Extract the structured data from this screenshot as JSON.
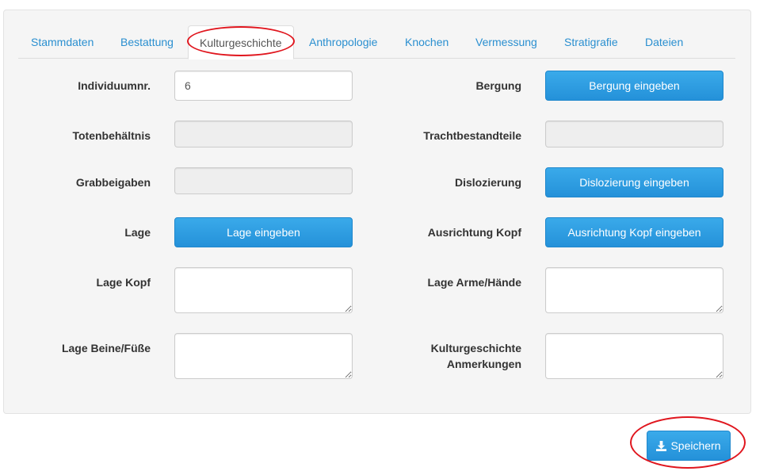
{
  "tabs": [
    {
      "label": "Stammdaten"
    },
    {
      "label": "Bestattung"
    },
    {
      "label": "Kulturgeschichte"
    },
    {
      "label": "Anthropologie"
    },
    {
      "label": "Knochen"
    },
    {
      "label": "Vermessung"
    },
    {
      "label": "Stratigrafie"
    },
    {
      "label": "Dateien"
    }
  ],
  "active_tab": "Kulturgeschichte",
  "form": {
    "individuumnr": {
      "label": "Individuumnr.",
      "value": "6"
    },
    "bergung": {
      "label": "Bergung",
      "button": "Bergung eingeben"
    },
    "totenbehaeltnis": {
      "label": "Totenbehältnis",
      "value": ""
    },
    "trachtbestandteile": {
      "label": "Trachtbestandteile",
      "value": ""
    },
    "grabbeigaben": {
      "label": "Grabbeigaben",
      "value": ""
    },
    "dislozierung": {
      "label": "Dislozierung",
      "button": "Dislozierung eingeben"
    },
    "lage": {
      "label": "Lage",
      "button": "Lage eingeben"
    },
    "ausrichtung_kopf": {
      "label": "Ausrichtung Kopf",
      "button": "Ausrichtung Kopf eingeben"
    },
    "lage_kopf": {
      "label": "Lage Kopf",
      "value": ""
    },
    "lage_arme_haende": {
      "label": "Lage Arme/Hände",
      "value": ""
    },
    "lage_beine_fuesse": {
      "label": "Lage Beine/Füße",
      "value": ""
    },
    "kulturgeschichte_anmerkungen": {
      "label": "Kulturgeschichte Anmerkungen",
      "value": ""
    }
  },
  "save_button": {
    "label": "Speichern",
    "icon": "download-icon"
  },
  "colors": {
    "accent": "#2a8fd0",
    "button": "#2491d9",
    "highlight_ellipse": "#e0161e"
  }
}
